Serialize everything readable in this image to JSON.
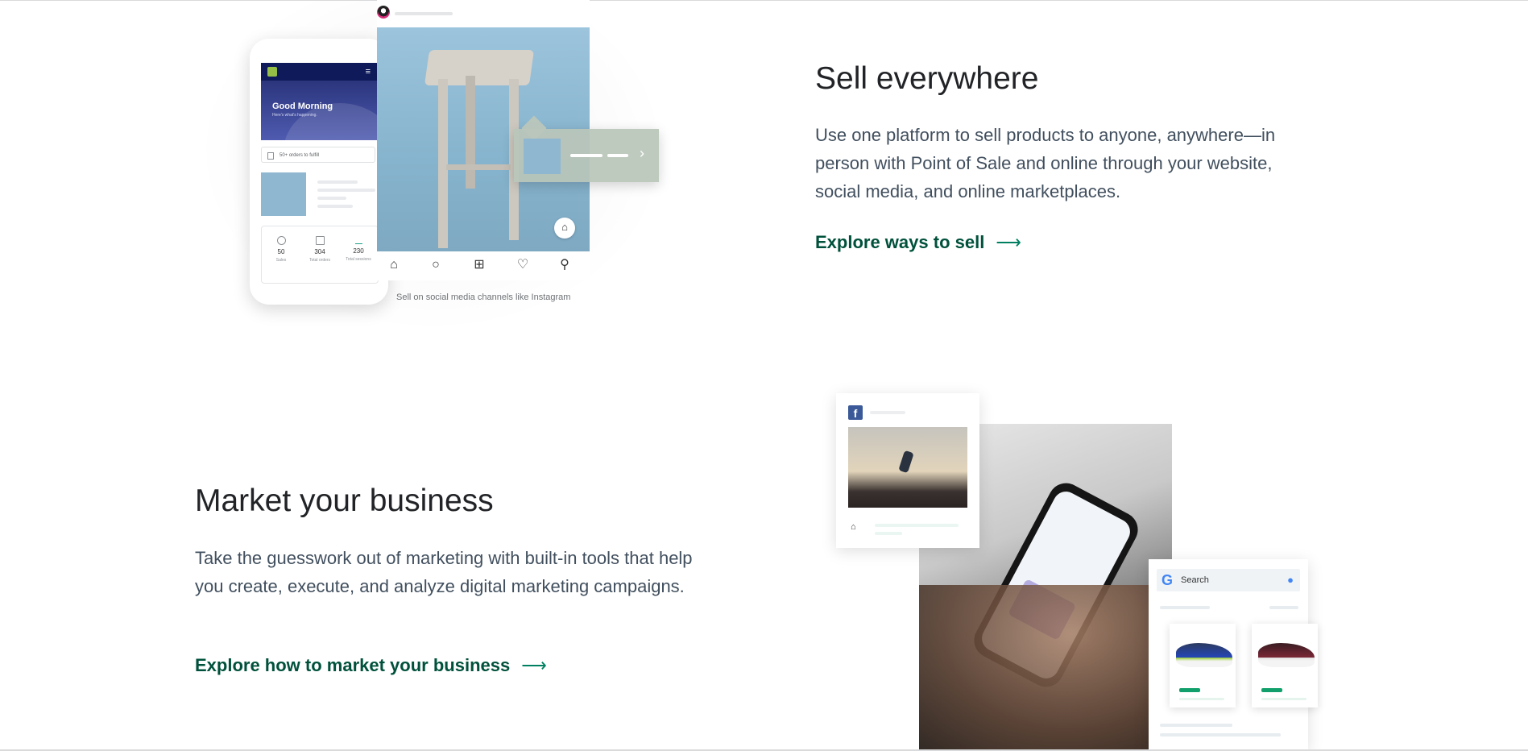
{
  "sections": {
    "sell": {
      "title": "Sell everywhere",
      "description": "Use one platform to sell products to anyone, anywhere—in person with Point of Sale and online through your website, social media, and online marketplaces.",
      "link_label": "Explore ways to sell",
      "link_arrow": "⟶",
      "illustration": {
        "caption": "Sell on social media channels like Instagram",
        "phone_app": {
          "greeting": "Good Morning",
          "greeting_sub": "Here's what's happening.",
          "orders_text": "50+ orders to fulfill",
          "stats": [
            {
              "value": "50",
              "label": "Sales"
            },
            {
              "value": "304",
              "label": "Total orders"
            },
            {
              "value": "230",
              "label": "Total sessions"
            }
          ]
        }
      }
    },
    "market": {
      "title": "Market your business",
      "description": "Take the guesswork out of marketing with built-in tools that help you create, execute, and analyze digital marketing campaigns.",
      "link_label": "Explore how to market your business",
      "link_arrow": "⟶",
      "illustration": {
        "google_search_placeholder": "Search",
        "facebook_logo": "f",
        "google_logo": "G"
      }
    }
  },
  "icons": {
    "home": "home-icon",
    "search": "search-icon",
    "add": "add-icon",
    "heart": "heart-icon",
    "profile": "profile-icon",
    "bag": "shopping-bag-icon",
    "mic": "mic-icon",
    "chevron": "chevron-right-icon"
  },
  "colors": {
    "link": "#00513b",
    "arrow": "#008060",
    "heading": "#212326",
    "body": "#414f5e"
  }
}
